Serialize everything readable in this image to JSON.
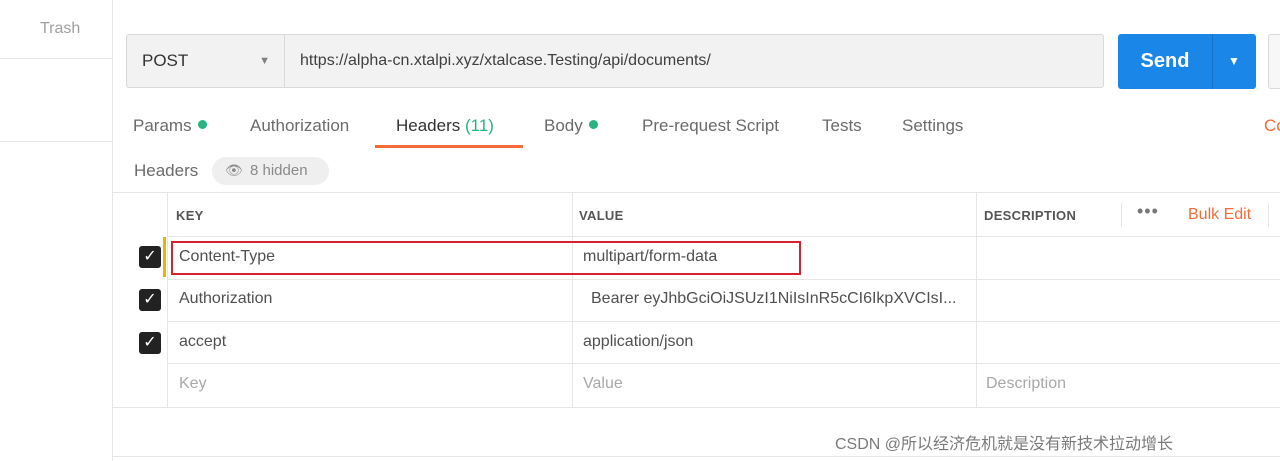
{
  "sidebar": {
    "trash_label": "Trash"
  },
  "request": {
    "method": "POST",
    "url": "https://alpha-cn.xtalpi.xyz/xtalcase.Testing/api/documents/",
    "send_label": "Send"
  },
  "tabs": [
    {
      "label": "Params",
      "dot": true
    },
    {
      "label": "Authorization"
    },
    {
      "label": "Headers",
      "count": "(11)",
      "active": true
    },
    {
      "label": "Body",
      "dot": true
    },
    {
      "label": "Pre-request Script"
    },
    {
      "label": "Tests"
    },
    {
      "label": "Settings"
    }
  ],
  "cookies_label": "Co",
  "headers_section": {
    "title": "Headers",
    "hidden_label": "8 hidden"
  },
  "table": {
    "columns": {
      "key": "KEY",
      "value": "VALUE",
      "description": "DESCRIPTION"
    },
    "more_label": "•••",
    "bulk_edit": "Bulk Edit",
    "rows": [
      {
        "checked": true,
        "key": "Content-Type",
        "value": "multipart/form-data"
      },
      {
        "checked": true,
        "key": "Authorization",
        "value": "Bearer eyJhbGciOiJSUzI1NiIsInR5cCI6IkpXVCIsI..."
      },
      {
        "checked": true,
        "key": "accept",
        "value": "application/json"
      }
    ],
    "placeholders": {
      "key": "Key",
      "value": "Value",
      "description": "Description"
    }
  },
  "colors": {
    "accent": "#f26b3a",
    "send": "#1a86e8",
    "success": "#26b47f",
    "highlight": "#d9202f"
  },
  "watermark": "CSDN @所以经济危机就是没有新技术拉动增长"
}
